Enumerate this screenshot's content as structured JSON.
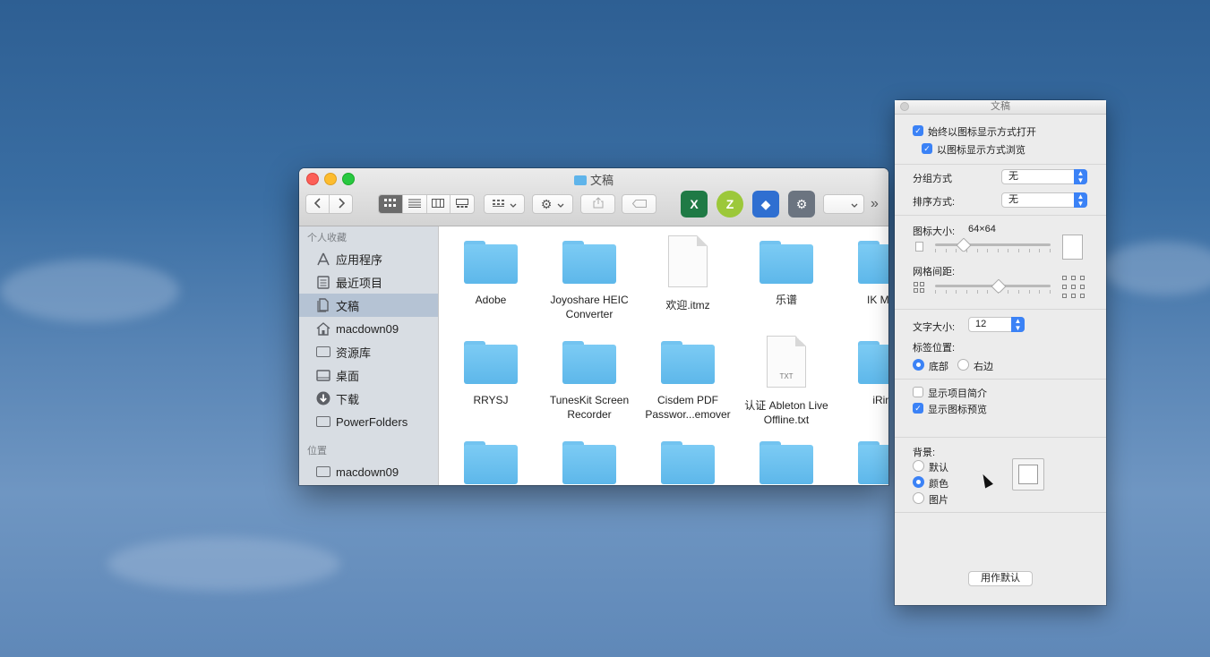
{
  "finder": {
    "window_title": "文稿",
    "toolbar": {
      "back_icon": "chevron-left-icon",
      "forward_icon": "chevron-right-icon",
      "view_modes": [
        "icon-view",
        "list-view",
        "column-view",
        "gallery-view"
      ],
      "group_icon": "group-icon",
      "action_icon": "gear-icon",
      "share_icon": "share-icon",
      "tag_icon": "tag-icon",
      "apps": [
        {
          "name": "excel-icon",
          "glyph": "X",
          "color": "#1f7a45"
        },
        {
          "name": "zy-app-icon",
          "glyph": "Z",
          "color": "#9cc83a"
        },
        {
          "name": "blue-app-icon",
          "glyph": "◆",
          "color": "#2f6fd1"
        },
        {
          "name": "robot-app-icon",
          "glyph": "⚙",
          "color": "#6b7480"
        }
      ],
      "overflow": "»"
    },
    "sidebar": {
      "favorites_header": "个人收藏",
      "favorites": [
        {
          "label": "应用程序",
          "icon": "applications-icon",
          "selected": false
        },
        {
          "label": "最近项目",
          "icon": "recents-icon",
          "selected": false
        },
        {
          "label": "文稿",
          "icon": "documents-icon",
          "selected": true
        },
        {
          "label": "macdown09",
          "icon": "home-icon",
          "selected": false
        },
        {
          "label": "资源库",
          "icon": "folder-icon",
          "selected": false
        },
        {
          "label": "桌面",
          "icon": "desktop-icon",
          "selected": false
        },
        {
          "label": "下载",
          "icon": "downloads-icon",
          "selected": false
        },
        {
          "label": "PowerFolders",
          "icon": "folder-icon",
          "selected": false
        }
      ],
      "locations_header": "位置",
      "locations": [
        {
          "label": "macdown09",
          "icon": "disk-icon",
          "selected": false
        }
      ]
    },
    "files": [
      {
        "name": "Adobe",
        "type": "folder"
      },
      {
        "name": "Joyoshare HEIC\nConverter",
        "type": "folder"
      },
      {
        "name": "欢迎.itmz",
        "type": "doc"
      },
      {
        "name": "乐谱",
        "type": "folder"
      },
      {
        "name": "IK Multi",
        "type": "folder"
      },
      {
        "name": "RRYSJ",
        "type": "folder"
      },
      {
        "name": "TunesKit Screen\nRecorder",
        "type": "folder"
      },
      {
        "name": "Cisdem PDF\nPasswor...emover",
        "type": "folder"
      },
      {
        "name": "认证 Ableton Live\nOffline.txt",
        "type": "txt"
      },
      {
        "name": "iRing",
        "type": "folder"
      },
      {
        "name": "",
        "type": "folder"
      },
      {
        "name": "",
        "type": "folder"
      },
      {
        "name": "",
        "type": "folder"
      },
      {
        "name": "",
        "type": "folder"
      },
      {
        "name": "",
        "type": "folder"
      }
    ],
    "txt_label": "TXT"
  },
  "inspector": {
    "title": "文稿",
    "always_open_icon_view": {
      "label": "始终以图标显示方式打开",
      "checked": true
    },
    "browse_icon_view": {
      "label": "以图标显示方式浏览",
      "checked": true
    },
    "group_by": {
      "label": "分组方式",
      "value": "无"
    },
    "sort_by": {
      "label": "排序方式:",
      "value": "无"
    },
    "icon_size": {
      "label": "图标大小:",
      "value": "64×64",
      "level": 0.24
    },
    "grid_spacing": {
      "label": "网格间距:",
      "level": 0.54
    },
    "text_size": {
      "label": "文字大小:",
      "value": "12"
    },
    "label_position": {
      "label": "标签位置:",
      "options": [
        "底部",
        "右边"
      ],
      "selected": "底部"
    },
    "show_item_info": {
      "label": "显示项目简介",
      "checked": false
    },
    "show_icon_preview": {
      "label": "显示图标预览",
      "checked": true
    },
    "background": {
      "label": "背景:",
      "options": [
        "默认",
        "颜色",
        "图片"
      ],
      "selected": "颜色"
    },
    "use_as_defaults": "用作默认"
  }
}
